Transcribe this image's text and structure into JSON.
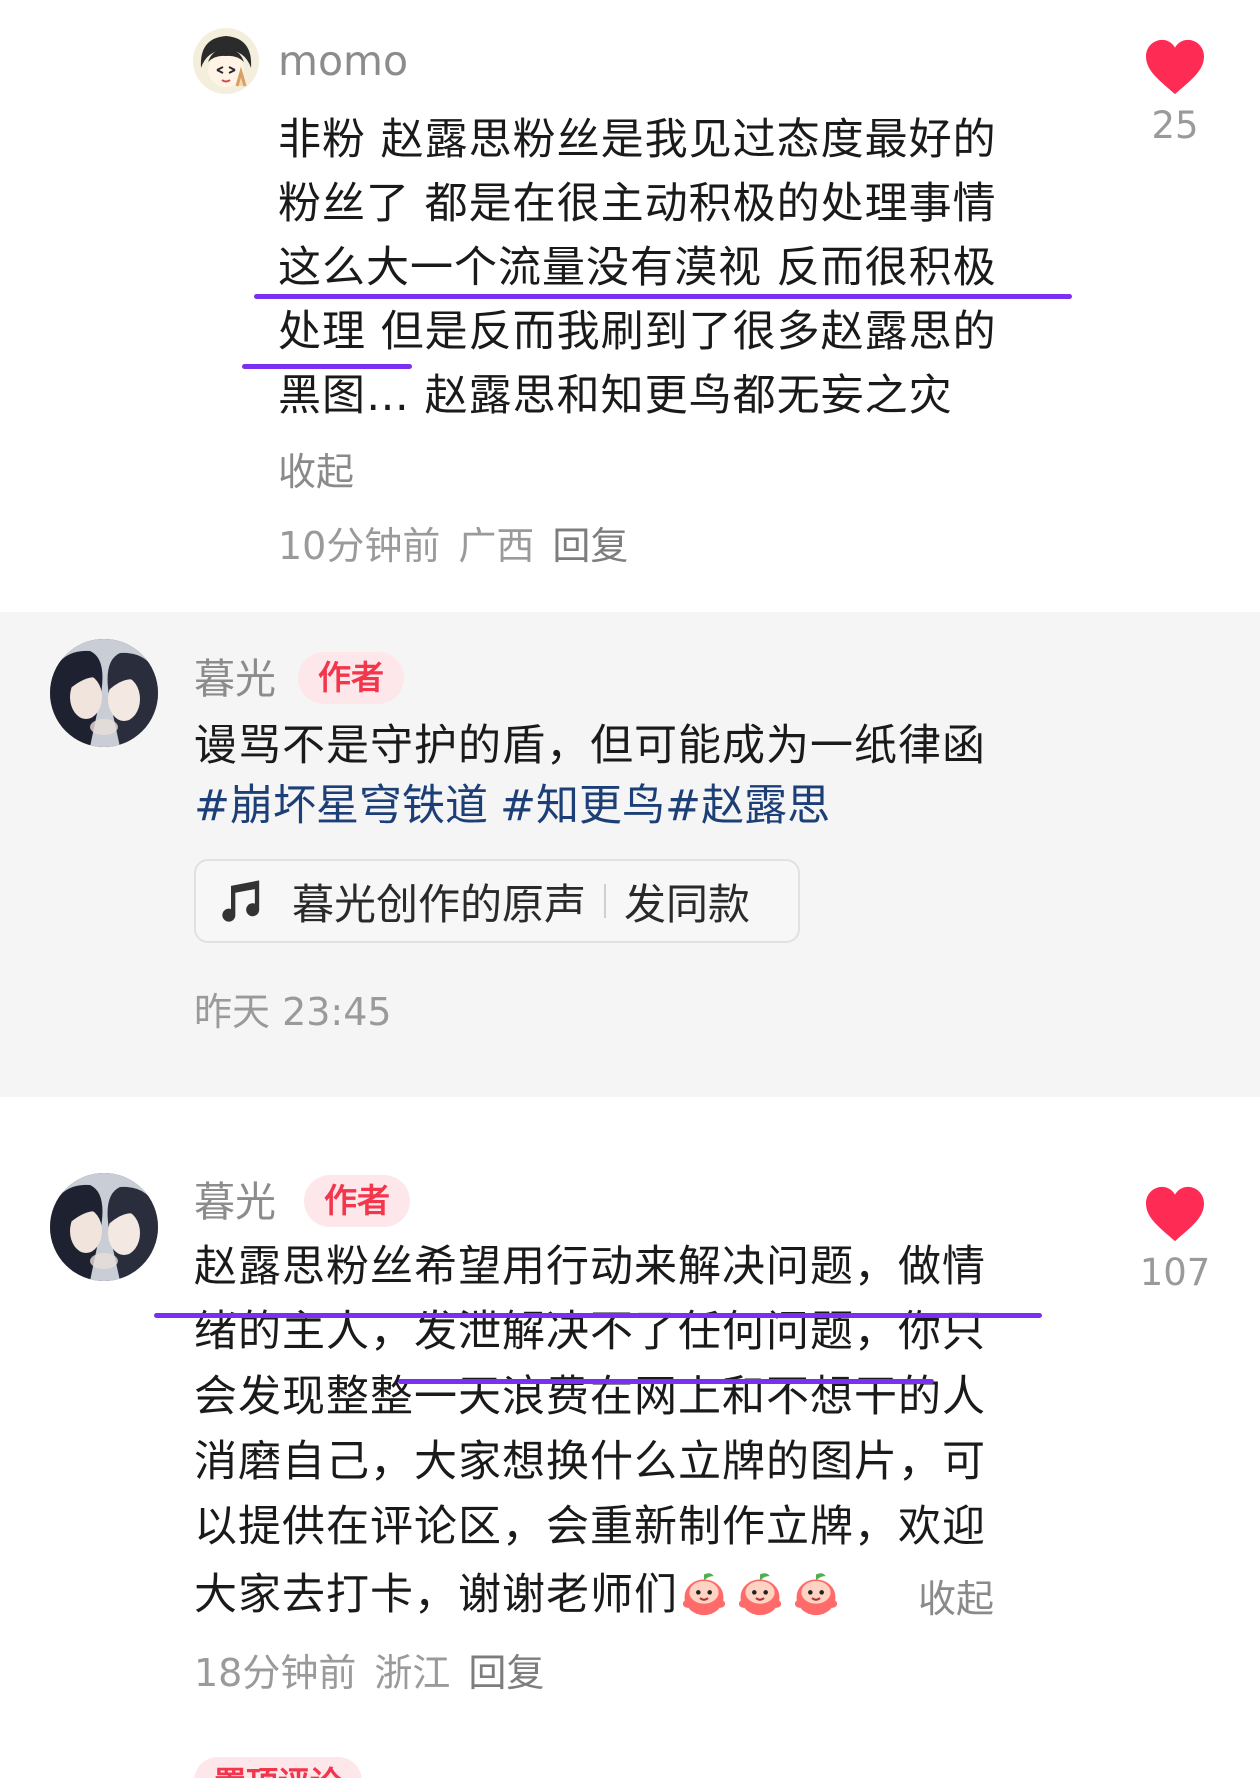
{
  "comment1": {
    "username": "momo",
    "lines": [
      "非粉 赵露思粉丝是我见过态度最好的",
      "粉丝了 都是在很主动积极的处理事情",
      "这么大一个流量没有漠视 反而很积极",
      "处理 但是反而我刷到了很多赵露思的",
      "黑图… 赵露思和知更鸟都无妄之灾"
    ],
    "collapse": "收起",
    "time": "10分钟前",
    "location": "广西",
    "reply": "回复",
    "likes": "25",
    "avatar_icon": "cartoon-girl-avatar-icon",
    "like_icon": "heart-icon",
    "like_color": "#fe2c55"
  },
  "post": {
    "username": "暮光",
    "badge": "作者",
    "text": "谩骂不是守护的盾，但可能成为一纸律函",
    "hashtags": [
      "#崩坏星穹铁道",
      "#知更鸟#赵露思"
    ],
    "audio_title": "暮光创作的原声",
    "audio_action": "发同款",
    "time": "昨天 23:45",
    "avatar_icon": "anime-character-avatar-icon",
    "audio_icon": "music-note-icon"
  },
  "comment2": {
    "username": "暮光",
    "badge": "作者",
    "lines": [
      "赵露思粉丝希望用行动来解决问题，做情",
      "绪的主人，发泄解决不了任何问题，你只",
      "会发现整整一天浪费在网上和不想干的人",
      "消磨自己，大家想换什么立牌的图片，可",
      "以提供在评论区，会重新制作立牌，欢迎"
    ],
    "last_line": "大家去打卡，谢谢老师们",
    "collapse": "收起",
    "time": "18分钟前",
    "location": "浙江",
    "reply": "回复",
    "likes": "107",
    "pin_badge": "置顶评论",
    "emoji_icon": "peach-emoji-icon",
    "like_icon": "heart-icon",
    "highlight_color": "#7b2ff0"
  }
}
